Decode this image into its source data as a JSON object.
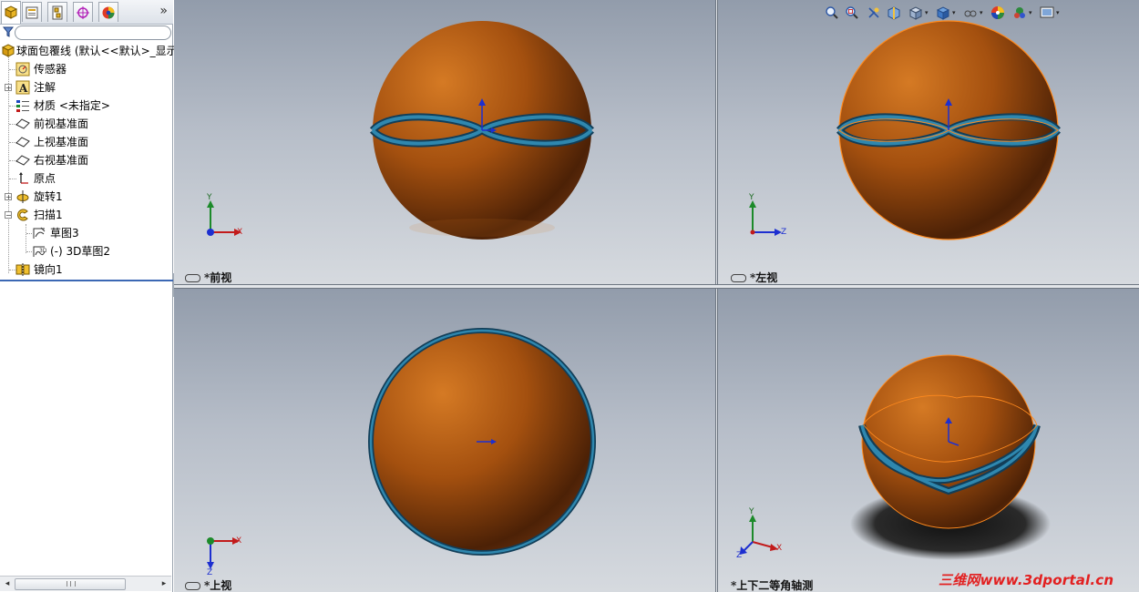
{
  "feature_manager": {
    "tabs": [
      {
        "icon": "feature-tree-icon"
      },
      {
        "icon": "property-manager-icon"
      },
      {
        "icon": "configuration-manager-icon"
      },
      {
        "icon": "dimxpert-icon"
      },
      {
        "icon": "display-manager-icon"
      }
    ],
    "more_label": "»",
    "filter_icon": "filter-icon",
    "root": {
      "label": "球面包覆线 (默认<<默认>_显示"
    },
    "items": [
      {
        "label": "传感器",
        "icon": "sensor-icon"
      },
      {
        "label": "注解",
        "icon": "annotations-icon"
      },
      {
        "label": "材质 <未指定>",
        "icon": "material-icon"
      },
      {
        "label": "前视基准面",
        "icon": "plane-icon"
      },
      {
        "label": "上视基准面",
        "icon": "plane-icon"
      },
      {
        "label": "右视基准面",
        "icon": "plane-icon"
      },
      {
        "label": "原点",
        "icon": "origin-icon"
      },
      {
        "label": "旋转1",
        "icon": "revolve-icon"
      },
      {
        "label": "扫描1",
        "icon": "sweep-icon"
      },
      {
        "label": "草图3",
        "icon": "sketch-icon"
      },
      {
        "label": "(-) 3D草图2",
        "icon": "3d-sketch-icon"
      },
      {
        "label": "镜向1",
        "icon": "mirror-icon"
      }
    ],
    "scrollbar": {
      "left": "◂",
      "right": "▸"
    }
  },
  "viewports": [
    {
      "name": "front",
      "label": "*前视",
      "axes": [
        "Y",
        "X"
      ]
    },
    {
      "name": "left",
      "label": "*左视",
      "axes": [
        "Y",
        "Z"
      ]
    },
    {
      "name": "top",
      "label": "*上视",
      "axes": [
        "X",
        "Z"
      ]
    },
    {
      "name": "dimetric",
      "label": "*上下二等角轴测",
      "axes": [
        "Y",
        "X",
        "Z"
      ]
    }
  ],
  "heads_up_toolbar": [
    "zoom-to-fit-icon",
    "zoom-to-area-icon",
    "previous-view-icon",
    "section-view-icon",
    "view-orientation-icon",
    "display-style-icon",
    "hide-show-items-icon",
    "edit-appearance-icon",
    "apply-scene-icon",
    "view-settings-icon"
  ],
  "watermark": "三维网www.3dportal.cn",
  "colors": {
    "sphere": "#b65a10",
    "ring": "#1f6486",
    "selection_edge": "#ff8a1e",
    "viewport_top": "#929cab",
    "viewport_bottom": "#d6dadf"
  }
}
